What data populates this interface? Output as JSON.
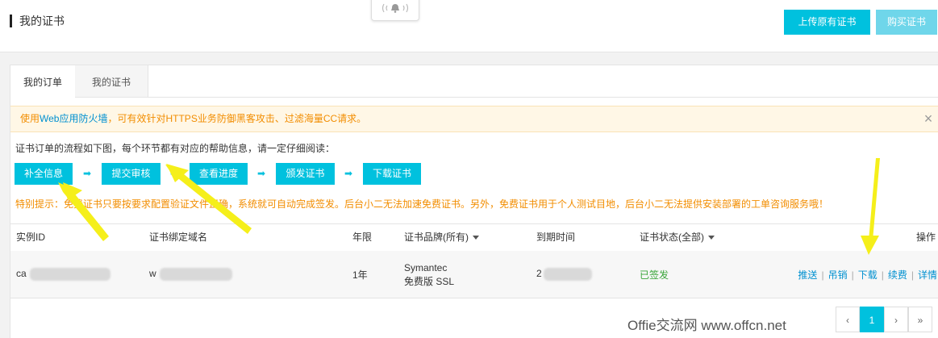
{
  "header": {
    "title": "我的证书",
    "upload_button": "上传原有证书",
    "buy_button": "购买证书"
  },
  "tabs": [
    {
      "label": "我的订单",
      "active": true
    },
    {
      "label": "我的证书",
      "active": false
    }
  ],
  "notice": {
    "prefix": "使用",
    "link": "Web应用防火墙",
    "suffix": "，可有效针对HTTPS业务防御黑客攻击、过滤海量CC请求。",
    "close_icon": "×"
  },
  "flow": {
    "intro": "证书订单的流程如下图，每个环节都有对应的帮助信息，请一定仔细阅读：",
    "steps": [
      "补全信息",
      "提交审核",
      "查看进度",
      "颁发证书",
      "下载证书"
    ],
    "arrow": "➡"
  },
  "warning": "特别提示：免费证书只要按要求配置验证文件正确，系统就可自动完成签发。后台小二无法加速免费证书。另外，免费证书用于个人测试目地，后台小二无法提供安装部署的工单咨询服务哦！",
  "table": {
    "columns": [
      "实例ID",
      "证书绑定域名",
      "年限",
      "证书品牌(所有)",
      "到期时间",
      "证书状态(全部)",
      "操作"
    ],
    "rows": [
      {
        "instance_id_prefix": "ca",
        "domain_prefix": "w",
        "years": "1年",
        "brand_line1": "Symantec",
        "brand_line2": "免费版 SSL",
        "expiry_prefix": "2",
        "status": "已签发",
        "actions": [
          "推送",
          "吊销",
          "下载",
          "续费",
          "详情"
        ]
      }
    ]
  },
  "pagination": {
    "prev": "‹",
    "current": "1",
    "next": "›",
    "last": "»"
  },
  "watermark": "Offie交流网 www.offcn.net",
  "colors": {
    "accent": "#00c1de",
    "warning": "#f28d00",
    "link": "#0090d0",
    "success": "#3aa53a",
    "callout": "#f5ef1a"
  },
  "icons": {
    "bell": "bell-icon",
    "close": "close-icon"
  }
}
